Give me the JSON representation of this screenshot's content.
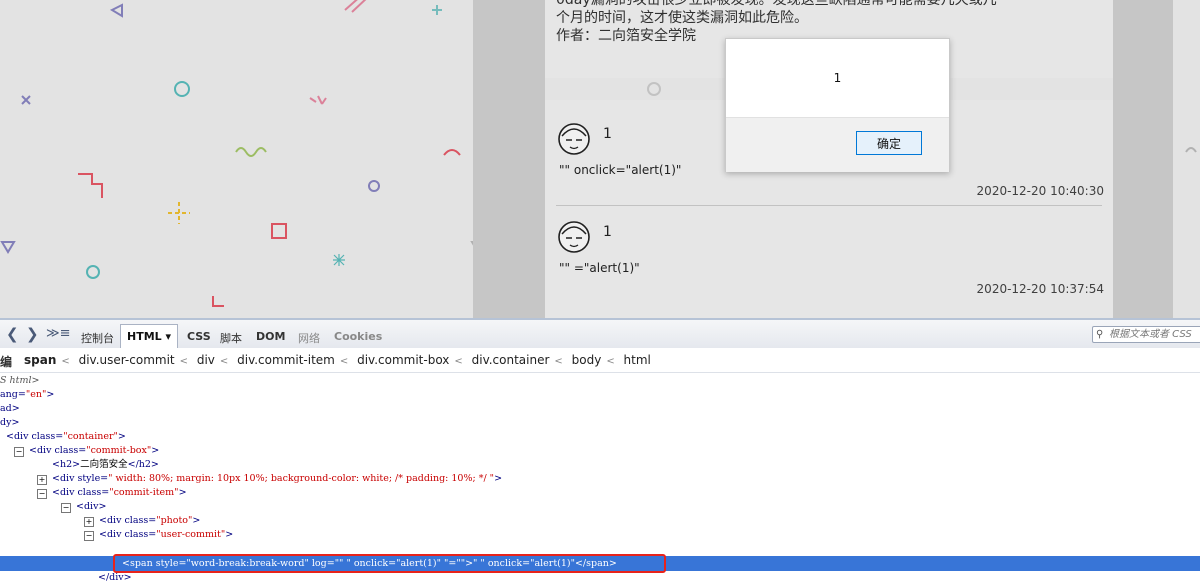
{
  "article": {
    "lines": [
      "0day漏洞的攻击很少立即被发现。发现这些缺陷通常可能需要几天或几",
      "个月的时间，这才使这类漏洞如此危险。",
      "作者：二向箔安全学院"
    ]
  },
  "comments": [
    {
      "name": "1",
      "text": "\"\" onclick=\"alert(1)\"",
      "time": "2020-12-20 10:40:30"
    },
    {
      "name": "1",
      "text": "\"\" =\"alert(1)\"",
      "time": "2020-12-20 10:37:54"
    }
  ],
  "alert": {
    "message": "1",
    "ok_label": "确定"
  },
  "devtools": {
    "tabs": [
      "控制台",
      "HTML ▾",
      "CSS",
      "脚本",
      "DOM",
      "网络",
      "Cookies"
    ],
    "search_placeholder": "根据文本或者 CSS",
    "breadcrumb_first": "编",
    "breadcrumb": [
      "span",
      "div.user-commit",
      "div",
      "div.commit-item",
      "div.commit-box",
      "div.container",
      "body",
      "html"
    ],
    "tree": {
      "l0": "S html>",
      "l1_tag": "ang=",
      "l1_val": "\"en\"",
      "l2": "ad>",
      "l3": "dy>",
      "l4_tag": "<div  class=",
      "l4_val": "\"container\"",
      "l5_tag": "<div  class=",
      "l5_val": "\"commit-box\"",
      "l6_open": "<h2>",
      "l6_text": "二向箔安全",
      "l6_close": "</h2>",
      "l7_tag": "<div  style=",
      "l7_val": "\" width: 80%; margin: 10px 10%; background-color: white; /* padding: 10%; */ \"",
      "l8_tag": "<div  class=",
      "l8_val": "\"commit-item\"",
      "l9": "<div>",
      "l10_tag": "<div  class=",
      "l10_val": "\"photo\"",
      "l11_tag": "<div  class=",
      "l11_val": "\"user-commit\"",
      "selected": "<span  style=\"word-break:break-word\"  log=\"\" \"  onclick=\"alert(1)\"  \"=\"\">\" \" onclick=\"alert(1)\"</span>",
      "l13": "</div>"
    }
  }
}
